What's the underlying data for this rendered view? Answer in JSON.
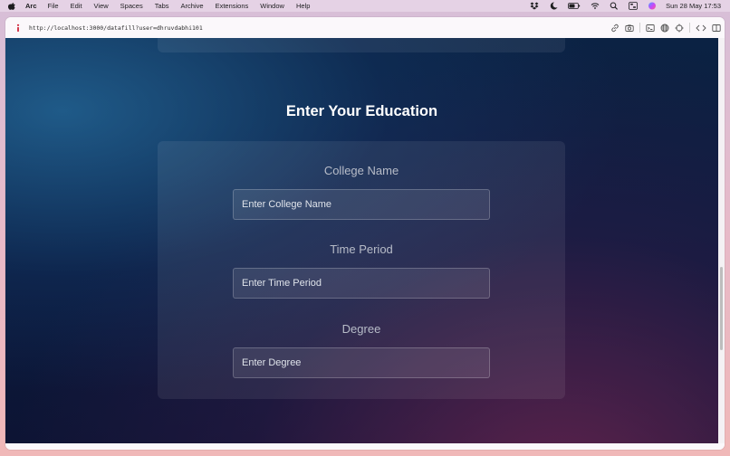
{
  "menubar": {
    "app_name": "Arc",
    "items": [
      "File",
      "Edit",
      "View",
      "Spaces",
      "Tabs",
      "Archive",
      "Extensions",
      "Window",
      "Help"
    ],
    "status_icons": [
      "dropbox-icon",
      "moon-icon",
      "battery-icon",
      "wifi-icon",
      "spotlight-search-icon",
      "control-center-icon",
      "siri-icon"
    ],
    "clock": "Sun 28 May  17:53"
  },
  "browser": {
    "url": "http://localhost:3000/datafill?user=dhruvdabhi101",
    "tool_icons": [
      "link-icon",
      "camera-icon",
      "terminal-icon",
      "globe-icon",
      "target-icon",
      "code-icon",
      "sidebar-icon"
    ]
  },
  "education": {
    "title": "Enter Your Education",
    "fields": [
      {
        "label": "College Name",
        "placeholder": "Enter College Name"
      },
      {
        "label": "Time Period",
        "placeholder": "Enter Time Period"
      },
      {
        "label": "Degree",
        "placeholder": "Enter Degree"
      }
    ]
  },
  "colors": {
    "card_background": "#ffffff13",
    "title_text": "#ffffff",
    "label_text": "#b7bcc8",
    "page_dark": "#0a1b3e"
  }
}
